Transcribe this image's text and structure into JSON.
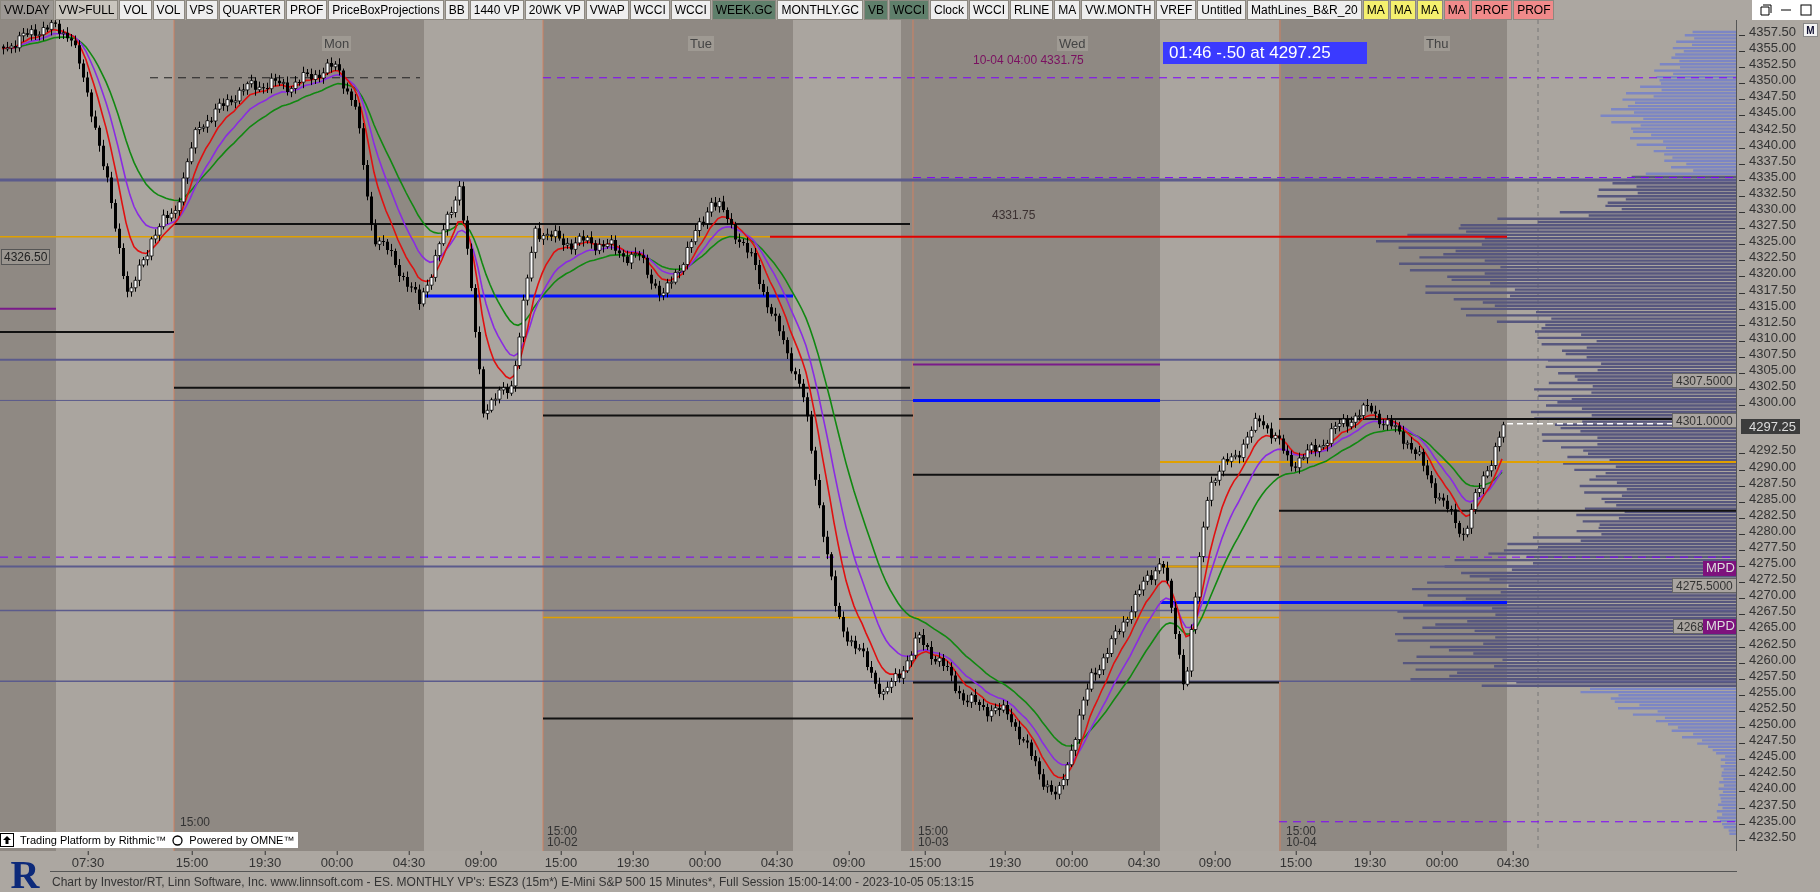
{
  "toolbar": {
    "buttons": [
      {
        "label": "VW.DAY",
        "color": "#9c9894"
      },
      {
        "label": "VW>FULL",
        "color": "#c9c5be"
      },
      {
        "label": "VOL",
        "color": "#eeeeee"
      },
      {
        "label": "VOL",
        "color": "#eeeeee"
      },
      {
        "label": "VPS",
        "color": "#eeeeee"
      },
      {
        "label": "QUARTER",
        "color": "#eeeeee"
      },
      {
        "label": "PROF",
        "color": "#eeeeee"
      },
      {
        "label": "PriceBoxProjections",
        "color": "#eeeeee"
      },
      {
        "label": "BB",
        "color": "#eeeeee"
      },
      {
        "label": "1440 VP",
        "color": "#eeeeee"
      },
      {
        "label": "20WK VP",
        "color": "#eeeeee"
      },
      {
        "label": "VWAP",
        "color": "#eeeeee"
      },
      {
        "label": "WCCI",
        "color": "#eeeeee"
      },
      {
        "label": "WCCI",
        "color": "#eeeeee"
      },
      {
        "label": "WEEK.GC",
        "color": "#5f7f6b"
      },
      {
        "label": "MONTHLY.GC",
        "color": "#eeeeee"
      },
      {
        "label": "VB",
        "color": "#5f7f6b"
      },
      {
        "label": "WCCI",
        "color": "#5f7f6b"
      },
      {
        "label": "Clock",
        "color": "#eeeeee"
      },
      {
        "label": "WCCI",
        "color": "#eeeeee"
      },
      {
        "label": "RLINE",
        "color": "#eeeeee"
      },
      {
        "label": "MA",
        "color": "#eeeeee"
      },
      {
        "label": "VW.MONTH",
        "color": "#eeeeee"
      },
      {
        "label": "VREF",
        "color": "#eeeeee"
      },
      {
        "label": "Untitled",
        "color": "#eeeeee"
      },
      {
        "label": "MathLines_B&R_20",
        "color": "#eeeeee"
      },
      {
        "label": "MA",
        "color": "#f5f06e"
      },
      {
        "label": "MA",
        "color": "#f5f06e"
      },
      {
        "label": "MA",
        "color": "#f5f06e"
      },
      {
        "label": "MA",
        "color": "#f08a8a"
      },
      {
        "label": "PROF",
        "color": "#f08a8a"
      },
      {
        "label": "PROF",
        "color": "#f08a8a"
      }
    ]
  },
  "chart": {
    "day_labels": [
      "Mon",
      "Tue",
      "Wed",
      "Thu"
    ],
    "annotations": [
      {
        "kind": "pink",
        "text": "10-04 04:00 4331.75"
      },
      {
        "kind": "grey",
        "text": "4331.75"
      },
      {
        "kind": "boxed",
        "text": "4326.50"
      }
    ],
    "quote": "01:46  -.50 at 4297.25",
    "session_markers": [
      {
        "time": "15:00"
      },
      {
        "time": "15:00",
        "date": "10-02"
      },
      {
        "time": "15:00",
        "date": "10-03"
      },
      {
        "time": "15:00",
        "date": "10-04"
      }
    ],
    "badges": [
      "Trading Platform by Rithmic™",
      "Powered by OMNE™"
    ],
    "tags": [
      {
        "kind": "level",
        "text": "4307.5000"
      },
      {
        "kind": "level",
        "text": "4301.0000"
      },
      {
        "kind": "mpd",
        "text": "MPD"
      },
      {
        "kind": "level",
        "text": "4275.5000"
      },
      {
        "kind": "level",
        "text": "4268"
      },
      {
        "kind": "mpd",
        "text": "MPD"
      }
    ]
  },
  "price_axis": {
    "m_button": "M",
    "labels_upper": [
      "4357.50",
      "4355.00",
      "4352.50",
      "4350.00",
      "4347.50",
      "4345.00",
      "4342.50",
      "4340.00",
      "4337.50",
      "4335.00",
      "4332.50",
      "4330.00",
      "4327.50",
      "4325.00",
      "4322.50",
      "4320.00",
      "4317.50",
      "4315.00",
      "4312.50",
      "4310.00",
      "4307.50",
      "4305.00",
      "4302.50",
      "4300.00"
    ],
    "last_price": "4297.25",
    "labels_lower": [
      "4292.50",
      "4290.00",
      "4287.50",
      "4285.00",
      "4282.50",
      "4280.00",
      "4277.50",
      "4275.00",
      "4272.50",
      "4270.00",
      "4267.50",
      "4265.00",
      "4262.50",
      "4260.00",
      "4257.50",
      "4255.00",
      "4252.50",
      "4250.00",
      "4247.50",
      "4245.00",
      "4242.50",
      "4240.00",
      "4237.50",
      "4235.00",
      "4232.50"
    ]
  },
  "time_axis": {
    "labels": [
      "07:30",
      "15:00",
      "19:30",
      "00:00",
      "04:30",
      "09:00",
      "15:00",
      "19:30",
      "00:00",
      "04:30",
      "09:00",
      "15:00",
      "19:30",
      "00:00",
      "04:30",
      "09:00",
      "15:00",
      "19:30",
      "00:00",
      "04:30"
    ]
  },
  "footer": {
    "logo": "R",
    "text": "Chart by Investor/RT, Linn Software, Inc. www.linnsoft.com - ES. MONTHLY VP's: ESZ3 (15m*) E-Mini S&P 500 15 Minutes*, Full Session 15:00-14:00 - 2023-10-05 05:13:15"
  }
}
